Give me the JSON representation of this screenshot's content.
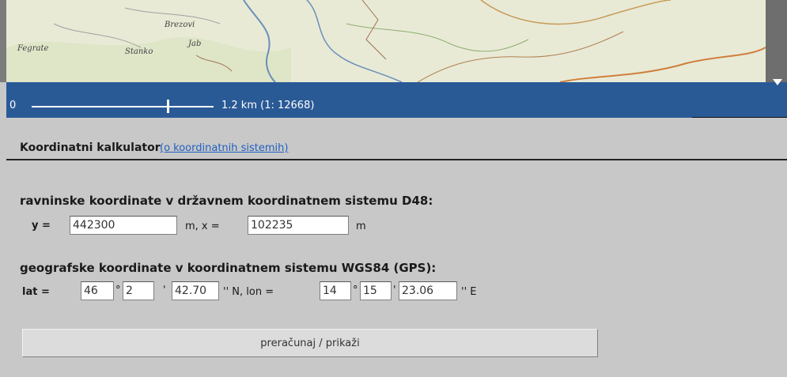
{
  "map": {
    "labels": [
      "Brezovi",
      "Fegrate",
      "Stanko",
      "Jab"
    ]
  },
  "scale": {
    "zero": "0",
    "text": "1.2 km (1: 12668)"
  },
  "calculator": {
    "title": "Koordinatni kalkulator",
    "link": "(o koordinatnih sistemih)",
    "d48": {
      "heading": "ravninske koordinate v državnem koordinatnem sistemu D48:",
      "y_label": "y =",
      "y_value": "442300",
      "y_unit": "m, x =",
      "x_value": "102235",
      "x_unit": "m"
    },
    "wgs": {
      "heading": "geografske koordinate v koordinatnem sistemu WGS84 (GPS):",
      "lat_label": "lat =",
      "lat_deg": "46",
      "lat_deg_sym": "°",
      "lat_min": "2",
      "lat_min_sym": "'",
      "lat_sec": "42.70",
      "lat_suffix": "'' N, lon =",
      "lon_deg": "14",
      "lon_deg_sym": "°",
      "lon_min": "15",
      "lon_min_sym": "'",
      "lon_sec": "23.06",
      "lon_suffix": "'' E"
    },
    "button": "preračunaj / prikaži"
  }
}
